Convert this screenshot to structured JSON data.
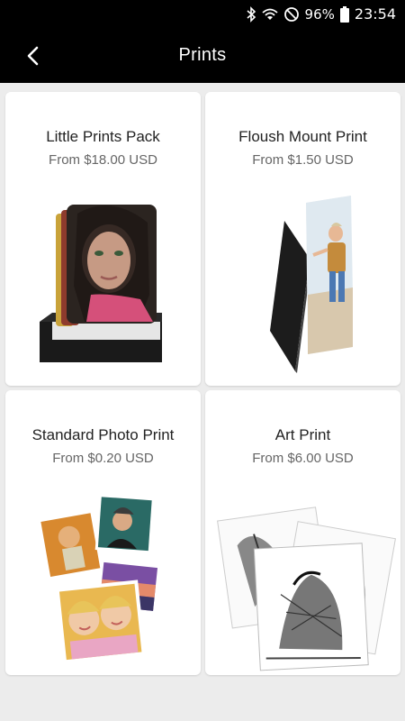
{
  "status": {
    "battery": "96%",
    "time": "23:54"
  },
  "header": {
    "title": "Prints"
  },
  "products": [
    {
      "name": "Little Prints Pack",
      "price": "From $18.00 USD"
    },
    {
      "name": "Floush Mount Print",
      "price": "From $1.50 USD"
    },
    {
      "name": "Standard Photo Print",
      "price": "From $0.20 USD"
    },
    {
      "name": "Art Print",
      "price": "From $6.00 USD"
    }
  ],
  "colors": {
    "bar": "#000000",
    "background": "#ececec",
    "card": "#ffffff"
  },
  "icons": [
    "bluetooth-icon",
    "wifi-icon",
    "do-not-disturb-icon",
    "battery-icon",
    "back-arrow-icon"
  ]
}
